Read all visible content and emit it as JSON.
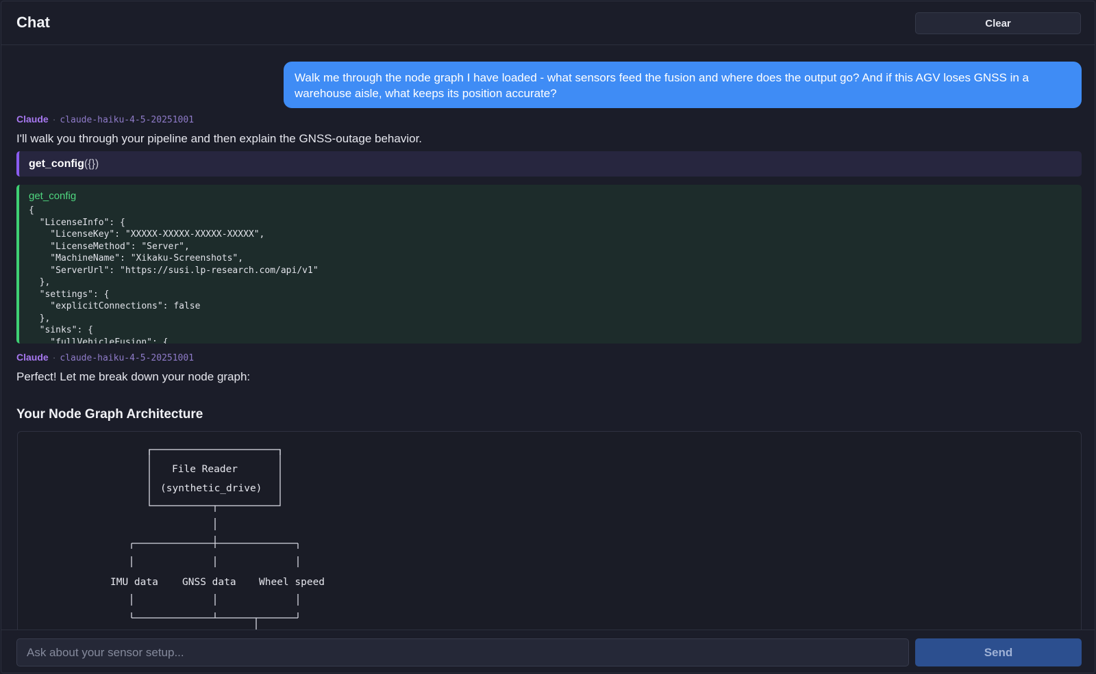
{
  "header": {
    "title": "Chat",
    "clear_label": "Clear"
  },
  "messages": {
    "user_text": "Walk me through the node graph I have loaded - what sensors feed the fusion and where does the output go? And if this AGV loses GNSS in a warehouse aisle, what keeps its position accurate?",
    "assistant1": {
      "who": "Claude",
      "sep": "·",
      "model": "claude-haiku-4-5-20251001",
      "text": "I'll walk you through your pipeline and then explain the GNSS-outage behavior."
    },
    "tool_call": {
      "name": "get_config",
      "args": "({})"
    },
    "tool_result": {
      "name": "get_config",
      "content": "{\n  \"LicenseInfo\": {\n    \"LicenseKey\": \"XXXXX-XXXXX-XXXXX-XXXXX\",\n    \"LicenseMethod\": \"Server\",\n    \"MachineName\": \"Xikaku-Screenshots\",\n    \"ServerUrl\": \"https://susi.lp-research.com/api/v1\"\n  },\n  \"settings\": {\n    \"explicitConnections\": false\n  },\n  \"sinks\": {\n    \"fullVehicleFusion\": {"
    },
    "assistant2": {
      "who": "Claude",
      "sep": "·",
      "model": "claude-haiku-4-5-20251001",
      "text": "Perfect! Let me break down your node graph:",
      "heading": "Your Node Graph Architecture"
    }
  },
  "diagram": {
    "file_reader": "File Reader",
    "source": "(synthetic_drive)",
    "imu": "IMU data",
    "gnss": "GNSS data",
    "wheel": "Wheel speed"
  },
  "input": {
    "placeholder": "Ask about your sensor setup...",
    "send_label": "Send"
  }
}
